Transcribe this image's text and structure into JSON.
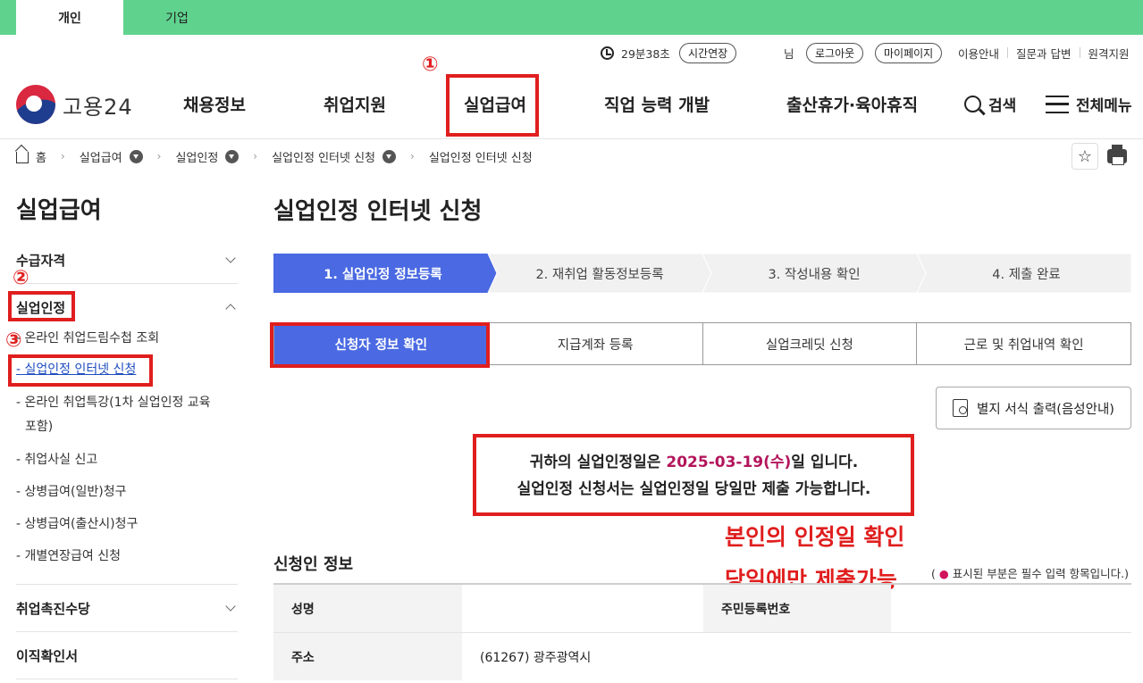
{
  "top_tabs": {
    "personal": "개인",
    "business": "기업"
  },
  "utility": {
    "timer": "29분38초",
    "extend": "시간연장",
    "user_suffix": "님",
    "logout": "로그아웃",
    "mypage": "마이페이지",
    "links": [
      "이용안내",
      "질문과 답변",
      "원격지원"
    ]
  },
  "logo": {
    "text": "고용24"
  },
  "gnb": [
    "채용정보",
    "취업지원",
    "실업급여",
    "직업 능력 개발",
    "출산휴가·육아휴직"
  ],
  "header_actions": {
    "search": "검색",
    "all_menu": "전체메뉴"
  },
  "breadcrumb": {
    "home": "홈",
    "items": [
      "실업급여",
      "실업인정",
      "실업인정 인터넷 신청",
      "실업인정 인터넷 신청"
    ]
  },
  "sidebar": {
    "title": "실업급여",
    "sections": [
      "수급자격",
      "실업인정",
      "취업촉진수당",
      "이직확인서"
    ],
    "sub_items": [
      "- 온라인 취업드림수첩 조회",
      "- 실업인정 인터넷 신청",
      "- 온라인 취업특강(1차 실업인정 교육",
      "포함)",
      "- 취업사실 신고",
      "- 상병급여(일반)청구",
      "- 상병급여(출산시)청구",
      "- 개별연장급여 신청"
    ]
  },
  "annotations": {
    "numbers": [
      "①",
      "②",
      "③"
    ],
    "line1": "본인의 인정일 확인",
    "line2": "당일에만 제출가능"
  },
  "main": {
    "title": "실업인정 인터넷 신청",
    "steps": [
      "1. 실업인정 정보등록",
      "2. 재취업 활동정보등록",
      "3. 작성내용 확인",
      "4. 제출 완료"
    ],
    "tabs": [
      "신청자 정보 확인",
      "지급계좌 등록",
      "실업크레딧 신청",
      "근로 및 취업내역 확인"
    ],
    "form_button": "별지 서식 출력(음성안내)",
    "notice": {
      "line1_pre": "귀하의 실업인정일은 ",
      "date": "2025-03-19(수)",
      "line1_post": "일 입니다.",
      "line2": "실업인정 신청서는 실업인정일 당일만 제출 가능합니다."
    },
    "section_title": "신청인 정보",
    "required_note": {
      "open": "( ",
      "dot": "●",
      "text": " 표시된 부분은 필수 입력 항목입니다.)"
    },
    "table": {
      "name_label": "성명",
      "name_value": "",
      "rrn_label": "주민등록번호",
      "rrn_value": "",
      "address_label": "주소",
      "address_value": "(61267) 광주광역시"
    }
  },
  "colors": {
    "brand_green": "#5fd38e",
    "active_blue": "#4a69e2",
    "annotation_red": "#e01e1e",
    "date_magenta": "#b3155b"
  }
}
